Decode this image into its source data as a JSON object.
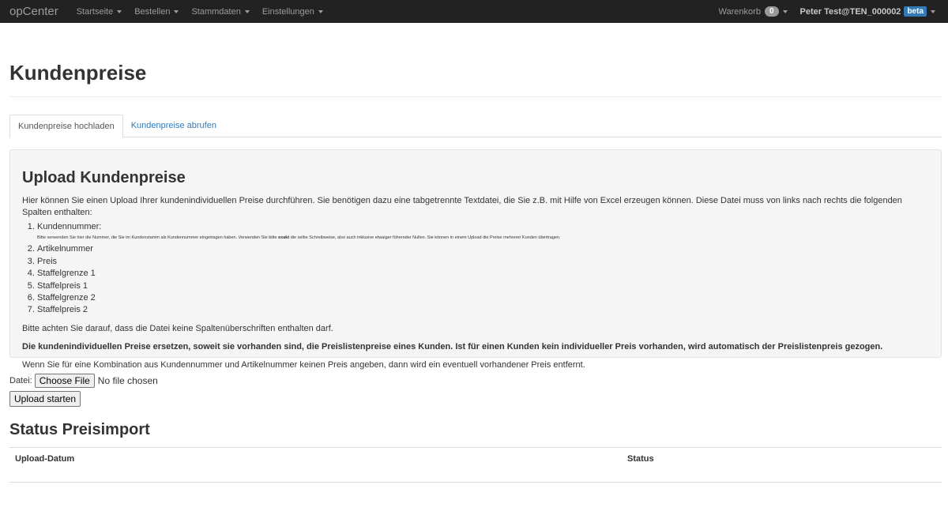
{
  "nav": {
    "brand": "opCenter",
    "items": [
      {
        "label": "Startseite"
      },
      {
        "label": "Bestellen"
      },
      {
        "label": "Stammdaten"
      },
      {
        "label": "Einstellungen"
      }
    ],
    "cart_label": "Warenkorb",
    "cart_count": "0",
    "user": "Peter Test@TEN_000002",
    "beta": "beta"
  },
  "page": {
    "title": "Kundenpreise",
    "tabs": [
      {
        "label": "Kundenpreise hochladen",
        "active": true
      },
      {
        "label": "Kundenpreise abrufen",
        "active": false
      }
    ]
  },
  "upload": {
    "heading": "Upload Kundenpreise",
    "intro": "Hier können Sie einen Upload Ihrer kundenindividuellen Preise durchführen. Sie benötigen dazu eine tabgetrennte Textdatei, die Sie z.B. mit Hilfe von Excel erzeugen können. Diese Datei muss von links nach rechts die folgenden Spalten enthalten:",
    "col1": "Kundennummer:",
    "col1_note_a": "Bitte verwenden Sie hier die Nummer, die Sie im Kundenstamm als Kundennummer eingetragen haben. Verwenden Sie bitte ",
    "col1_note_b": "exakt",
    "col1_note_c": " die selbe Schreibweise, also auch inklusive etwaiger führender Nullen. Sie können in einem Upload die Preise mehrerer Kunden übertragen.",
    "columns": [
      "Artikelnummer",
      "Preis",
      "Staffelgrenze 1",
      "Staffelpreis 1",
      "Staffelgrenze 2",
      "Staffelpreis 2"
    ],
    "note1": "Bitte achten Sie darauf, dass die Datei keine Spaltenüberschriften enthalten darf.",
    "note2": "Die kundenindividuellen Preise ersetzen, soweit sie vorhanden sind, die Preislistenpreise eines Kunden. Ist für einen Kunden kein individueller Preis vorhanden, wird automatisch der Preislistenpreis gezogen.",
    "note3": "Wenn Sie für eine Kombination aus Kundennummer und Artikelnummer keinen Preis angeben, dann wird ein eventuell vorhandener Preis entfernt."
  },
  "form": {
    "file_label": "Datei:",
    "choose_file": "Choose File",
    "no_file": "No file chosen",
    "submit": "Upload starten"
  },
  "status": {
    "heading": "Status Preisimport",
    "col_date": "Upload-Datum",
    "col_status": "Status"
  }
}
